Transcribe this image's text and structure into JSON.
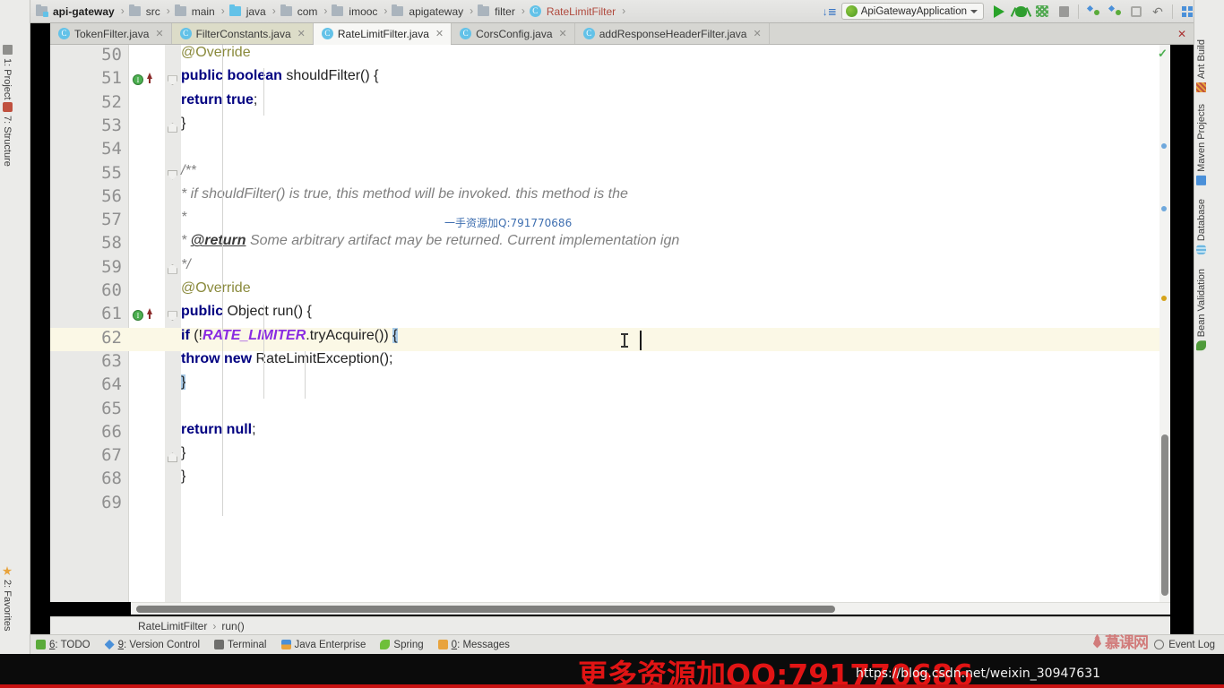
{
  "window": {
    "app": "IntelliJ IDEA",
    "project": "api-gateway"
  },
  "toolbar": {
    "breadcrumbs": [
      {
        "label": "api-gateway",
        "icon": "folder-module-icon"
      },
      {
        "label": "src",
        "icon": "folder-icon"
      },
      {
        "label": "main",
        "icon": "folder-icon"
      },
      {
        "label": "java",
        "icon": "folder-source-icon"
      },
      {
        "label": "com",
        "icon": "folder-icon"
      },
      {
        "label": "imooc",
        "icon": "folder-icon"
      },
      {
        "label": "apigateway",
        "icon": "folder-icon"
      },
      {
        "label": "filter",
        "icon": "folder-icon"
      },
      {
        "label": "RateLimitFilter",
        "icon": "java-class-icon"
      }
    ],
    "separator": "›",
    "run_config": "ApiGatewayApplication",
    "buttons": [
      {
        "name": "sort-toggle-icon",
        "label": ""
      },
      {
        "name": "run-button",
        "label": "Run"
      },
      {
        "name": "debug-button",
        "label": "Debug"
      },
      {
        "name": "run-with-coverage-button",
        "label": "Run with Coverage"
      },
      {
        "name": "stop-button",
        "label": "Stop"
      },
      {
        "name": "vcs-update-button",
        "label": "Update Project"
      },
      {
        "name": "vcs-commit-button",
        "label": "Commit"
      },
      {
        "name": "compare-button",
        "label": "Compare"
      },
      {
        "name": "rollback-button",
        "label": "Rollback"
      },
      {
        "name": "settings-button",
        "label": "Settings"
      },
      {
        "name": "search-everywhere-button",
        "label": "Search Everywhere"
      }
    ]
  },
  "editor_tabs": [
    {
      "label": "TokenFilter.java",
      "icon": "java-class-icon",
      "active": false,
      "style": "normal"
    },
    {
      "label": "FilterConstants.java",
      "icon": "java-class-icon",
      "active": false,
      "style": "yellowish"
    },
    {
      "label": "RateLimitFilter.java",
      "icon": "java-class-icon",
      "active": true,
      "style": "normal"
    },
    {
      "label": "CorsConfig.java",
      "icon": "java-class-icon",
      "active": false,
      "style": "normal"
    },
    {
      "label": "addResponseHeaderFilter.java",
      "icon": "java-class-icon",
      "active": false,
      "style": "normal"
    }
  ],
  "left_strip": [
    {
      "label": "1: Project",
      "icon": "project-icon"
    },
    {
      "label": "7: Structure",
      "icon": "structure-icon"
    },
    {
      "label": "2: Favorites",
      "icon": "favorites-star-icon"
    }
  ],
  "right_strip": [
    {
      "label": "Ant Build",
      "icon": "ant-build-icon"
    },
    {
      "label": "Maven Projects",
      "icon": "maven-icon"
    },
    {
      "label": "Database",
      "icon": "database-icon"
    },
    {
      "label": "Bean Validation",
      "icon": "bean-validation-icon"
    }
  ],
  "code": {
    "first_line": 50,
    "lines": [
      {
        "n": 50,
        "segments": [
          {
            "t": "    ",
            "c": ""
          },
          {
            "t": "@Override",
            "c": "ann"
          }
        ]
      },
      {
        "n": 51,
        "segments": [
          {
            "t": "    ",
            "c": ""
          },
          {
            "t": "public boolean",
            "c": "k"
          },
          {
            "t": " shouldFilter() {",
            "c": ""
          }
        ],
        "gutter": "override-impl-marker"
      },
      {
        "n": 52,
        "segments": [
          {
            "t": "        ",
            "c": ""
          },
          {
            "t": "return true",
            "c": "k"
          },
          {
            "t": ";",
            "c": ""
          }
        ]
      },
      {
        "n": 53,
        "segments": [
          {
            "t": "    }",
            "c": ""
          }
        ]
      },
      {
        "n": 54,
        "segments": [
          {
            "t": "",
            "c": ""
          }
        ]
      },
      {
        "n": 55,
        "segments": [
          {
            "t": "    /**",
            "c": "cmt"
          }
        ]
      },
      {
        "n": 56,
        "segments": [
          {
            "t": "     * if shouldFilter() is true, this method will be invoked. this method is the",
            "c": "cmt"
          }
        ]
      },
      {
        "n": 57,
        "segments": [
          {
            "t": "     *",
            "c": "cmt"
          }
        ]
      },
      {
        "n": 58,
        "segments": [
          {
            "t": "     * ",
            "c": "cmt"
          },
          {
            "t": "@return",
            "c": "cmt-tag"
          },
          {
            "t": " Some arbitrary artifact may be returned. Current implementation ign",
            "c": "cmt"
          }
        ]
      },
      {
        "n": 59,
        "segments": [
          {
            "t": "     */",
            "c": "cmt"
          }
        ]
      },
      {
        "n": 60,
        "segments": [
          {
            "t": "    ",
            "c": ""
          },
          {
            "t": "@Override",
            "c": "ann"
          }
        ]
      },
      {
        "n": 61,
        "segments": [
          {
            "t": "    ",
            "c": ""
          },
          {
            "t": "public",
            "c": "k"
          },
          {
            "t": " Object run() {",
            "c": ""
          }
        ],
        "gutter": "override-impl-marker"
      },
      {
        "n": 62,
        "segments": [
          {
            "t": "        ",
            "c": ""
          },
          {
            "t": "if",
            "c": "k"
          },
          {
            "t": " (!",
            "c": ""
          },
          {
            "t": "RATE_LIMITER",
            "c": "field"
          },
          {
            "t": ".tryAcquire()) ",
            "c": ""
          },
          {
            "t": "{",
            "c": "brace-hl"
          }
        ],
        "highlight": true
      },
      {
        "n": 63,
        "segments": [
          {
            "t": "            ",
            "c": ""
          },
          {
            "t": "throw new",
            "c": "k"
          },
          {
            "t": " RateLimitException();",
            "c": ""
          }
        ]
      },
      {
        "n": 64,
        "segments": [
          {
            "t": "        ",
            "c": ""
          },
          {
            "t": "}",
            "c": "brace-hl"
          }
        ]
      },
      {
        "n": 65,
        "segments": [
          {
            "t": "",
            "c": ""
          }
        ]
      },
      {
        "n": 66,
        "segments": [
          {
            "t": "        ",
            "c": ""
          },
          {
            "t": "return null",
            "c": "k"
          },
          {
            "t": ";",
            "c": ""
          }
        ]
      },
      {
        "n": 67,
        "segments": [
          {
            "t": "    }",
            "c": ""
          }
        ]
      },
      {
        "n": 68,
        "segments": [
          {
            "t": "}",
            "c": ""
          }
        ]
      },
      {
        "n": 69,
        "segments": [
          {
            "t": "",
            "c": ""
          }
        ]
      }
    ]
  },
  "nav_breadcrumb": {
    "class": "RateLimitFilter",
    "separator": "›",
    "method": "run()"
  },
  "statusbar": {
    "items": [
      {
        "num": "6",
        "label": ": TODO",
        "icon": "todo-icon"
      },
      {
        "num": "9",
        "label": ": Version Control",
        "icon": "version-control-icon"
      },
      {
        "num": "",
        "label": "Terminal",
        "icon": "terminal-icon"
      },
      {
        "num": "",
        "label": "Java Enterprise",
        "icon": "java-enterprise-icon"
      },
      {
        "num": "",
        "label": "Spring",
        "icon": "spring-icon"
      },
      {
        "num": "0",
        "label": ": Messages",
        "icon": "messages-icon"
      }
    ],
    "event_log": "Event Log"
  },
  "watermarks": {
    "code_overlay": "一手资源加Q:791770686",
    "bottom_red": "更多资源加QQ:791770686",
    "bottom_url": "https://blog.csdn.net/weixin_30947631",
    "imooc": "慕课网"
  },
  "colors": {
    "accent_blue": "#63c2e8",
    "keyword": "#000080",
    "comment": "#808080",
    "field": "#8a2be2",
    "annotation": "#8a8a3c",
    "highlight_line": "#fbf8e6",
    "brace_match": "#a8cbe8",
    "watermark_red": "#e11414"
  }
}
